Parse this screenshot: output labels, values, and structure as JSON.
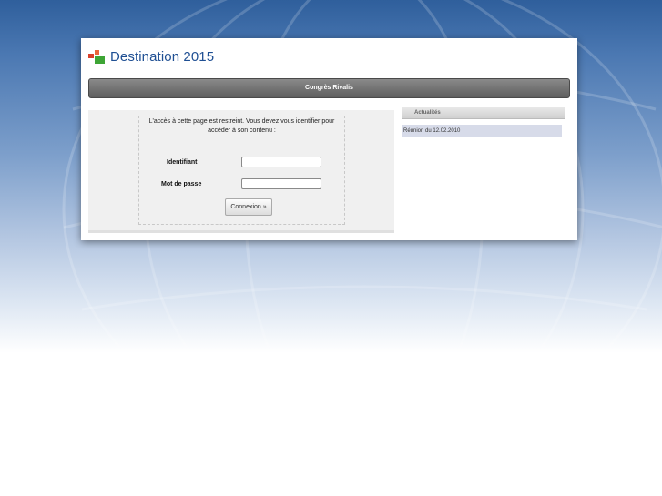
{
  "site": {
    "title": "Destination 2015"
  },
  "page": {
    "heading": "Congrès Rivalis"
  },
  "login": {
    "message": "L'accès à cette page est restreint. Vous devez vous identifier pour accéder à son contenu :",
    "username_label": "Identifiant",
    "username_value": "",
    "password_label": "Mot de passe",
    "password_value": "",
    "submit_label": "Connexion »"
  },
  "news": {
    "header": "Actualités",
    "items": [
      "Réunion du 12.02.2010"
    ]
  }
}
